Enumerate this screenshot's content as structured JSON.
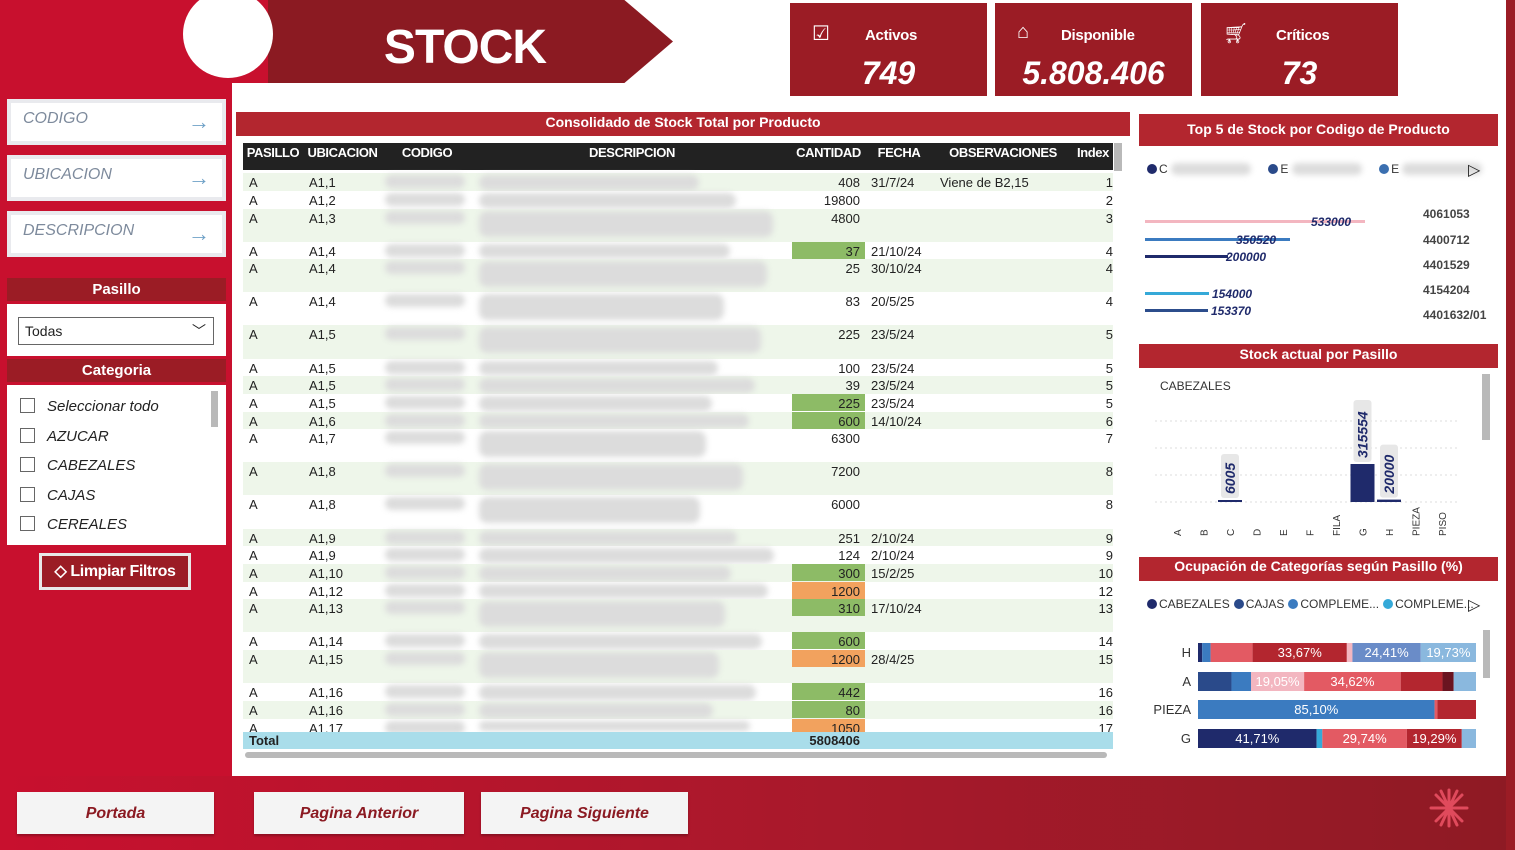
{
  "header": {
    "title": "STOCK"
  },
  "kpis": [
    {
      "label": "Activos",
      "value": "749",
      "icon": "checklist-icon"
    },
    {
      "label": "Disponible",
      "value": "5.808.406",
      "icon": "warehouse-icon"
    },
    {
      "label": "Críticos",
      "value": "73",
      "icon": "cart-icon"
    }
  ],
  "filters": {
    "codigo_placeholder": "CODIGO",
    "ubicacion_placeholder": "UBICACION",
    "descripcion_placeholder": "DESCRIPCION",
    "pasillo_label": "Pasillo",
    "pasillo_value": "Todas",
    "categoria_label": "Categoria",
    "categorias": [
      "Seleccionar todo",
      "AZUCAR",
      "CABEZALES",
      "CAJAS",
      "CEREALES"
    ],
    "clear_label": "Limpiar Filtros"
  },
  "nav": {
    "portada": "Portada",
    "anterior": "Pagina Anterior",
    "siguiente": "Pagina Siguiente"
  },
  "table": {
    "title": "Consolidado de Stock Total por Producto",
    "columns": [
      "PASILLO",
      "UBICACION",
      "CODIGO",
      "DESCRIPCION",
      "CANTIDAD",
      "FECHA",
      "OBSERVACIONES",
      "Index"
    ],
    "rows": [
      {
        "pasillo": "A",
        "ubicacion": "A1,1",
        "cantidad": "408",
        "fecha": "31/7/24",
        "obs": "Viene de B2,15",
        "index": "1",
        "shade": "w"
      },
      {
        "pasillo": "A",
        "ubicacion": "A1,2",
        "cantidad": "19800",
        "fecha": "",
        "obs": "",
        "index": "2",
        "shade": "w"
      },
      {
        "pasillo": "A",
        "ubicacion": "A1,3",
        "cantidad": "4800",
        "fecha": "",
        "obs": "",
        "index": "3",
        "shade": "w"
      },
      {
        "pasillo": "A",
        "ubicacion": "A1,4",
        "cantidad": "37",
        "fecha": "21/10/24",
        "obs": "",
        "index": "4",
        "shade": "g"
      },
      {
        "pasillo": "A",
        "ubicacion": "A1,4",
        "cantidad": "25",
        "fecha": "30/10/24",
        "obs": "",
        "index": "4",
        "shade": "w"
      },
      {
        "pasillo": "A",
        "ubicacion": "A1,4",
        "cantidad": "83",
        "fecha": "20/5/25",
        "obs": "",
        "index": "4",
        "shade": "w"
      },
      {
        "pasillo": "A",
        "ubicacion": "A1,5",
        "cantidad": "225",
        "fecha": "23/5/24",
        "obs": "",
        "index": "5",
        "shade": "w"
      },
      {
        "pasillo": "A",
        "ubicacion": "A1,5",
        "cantidad": "100",
        "fecha": "23/5/24",
        "obs": "",
        "index": "5",
        "shade": "w"
      },
      {
        "pasillo": "A",
        "ubicacion": "A1,5",
        "cantidad": "39",
        "fecha": "23/5/24",
        "obs": "",
        "index": "5",
        "shade": "w"
      },
      {
        "pasillo": "A",
        "ubicacion": "A1,5",
        "cantidad": "225",
        "fecha": "23/5/24",
        "obs": "",
        "index": "5",
        "shade": "g"
      },
      {
        "pasillo": "A",
        "ubicacion": "A1,6",
        "cantidad": "600",
        "fecha": "14/10/24",
        "obs": "",
        "index": "6",
        "shade": "g"
      },
      {
        "pasillo": "A",
        "ubicacion": "A1,7",
        "cantidad": "6300",
        "fecha": "",
        "obs": "",
        "index": "7",
        "shade": "w"
      },
      {
        "pasillo": "A",
        "ubicacion": "A1,8",
        "cantidad": "7200",
        "fecha": "",
        "obs": "",
        "index": "8",
        "shade": "w"
      },
      {
        "pasillo": "A",
        "ubicacion": "A1,8",
        "cantidad": "6000",
        "fecha": "",
        "obs": "",
        "index": "8",
        "shade": "w"
      },
      {
        "pasillo": "A",
        "ubicacion": "A1,9",
        "cantidad": "251",
        "fecha": "2/10/24",
        "obs": "",
        "index": "9",
        "shade": "w"
      },
      {
        "pasillo": "A",
        "ubicacion": "A1,9",
        "cantidad": "124",
        "fecha": "2/10/24",
        "obs": "",
        "index": "9",
        "shade": "w"
      },
      {
        "pasillo": "A",
        "ubicacion": "A1,10",
        "cantidad": "300",
        "fecha": "15/2/25",
        "obs": "",
        "index": "10",
        "shade": "g"
      },
      {
        "pasillo": "A",
        "ubicacion": "A1,12",
        "cantidad": "1200",
        "fecha": "",
        "obs": "",
        "index": "12",
        "shade": "o"
      },
      {
        "pasillo": "A",
        "ubicacion": "A1,13",
        "cantidad": "310",
        "fecha": "17/10/24",
        "obs": "",
        "index": "13",
        "shade": "g"
      },
      {
        "pasillo": "A",
        "ubicacion": "A1,14",
        "cantidad": "600",
        "fecha": "",
        "obs": "",
        "index": "14",
        "shade": "g"
      },
      {
        "pasillo": "A",
        "ubicacion": "A1,15",
        "cantidad": "1200",
        "fecha": "28/4/25",
        "obs": "",
        "index": "15",
        "shade": "o"
      },
      {
        "pasillo": "A",
        "ubicacion": "A1,16",
        "cantidad": "442",
        "fecha": "",
        "obs": "",
        "index": "16",
        "shade": "g"
      },
      {
        "pasillo": "A",
        "ubicacion": "A1,16",
        "cantidad": "80",
        "fecha": "",
        "obs": "",
        "index": "16",
        "shade": "g"
      },
      {
        "pasillo": "A",
        "ubicacion": "A1,17",
        "cantidad": "1050",
        "fecha": "",
        "obs": "",
        "index": "17",
        "shade": "o"
      }
    ],
    "total_label": "Total",
    "total_value": "5808406"
  },
  "top5": {
    "title": "Top 5 de Stock por Codigo de Producto",
    "legend": [
      "C",
      "E",
      "E"
    ],
    "legend_colors": [
      "#1f2a6b",
      "#2a4a8a",
      "#3b6fb0"
    ]
  },
  "chart_data": [
    {
      "type": "bar",
      "title": "Top 5 de Stock por Codigo de Producto",
      "categories": [
        "4061053",
        "4400712",
        "4401529",
        "4154204",
        "4401632/01"
      ],
      "values": [
        533000,
        350520,
        200000,
        154000,
        153370
      ],
      "colors": [
        "#f3b6c0",
        "#3b7bc0",
        "#1f2a6b",
        "#35a9d8",
        "#2c4d8c"
      ],
      "value_labels": [
        "533000",
        "350520",
        "200000",
        "154000",
        "153370"
      ]
    },
    {
      "type": "bar",
      "title": "Stock actual por Pasillo",
      "legend_label": "CABEZALES",
      "categories": [
        "A",
        "B",
        "C",
        "D",
        "E",
        "F",
        "FILA",
        "G",
        "H",
        "PIEZA",
        "PISO"
      ],
      "values": [
        0,
        0,
        6005,
        0,
        0,
        0,
        0,
        315554,
        20000,
        0,
        0
      ],
      "value_labels": [
        "",
        "",
        "6005",
        "",
        "",
        "",
        "",
        "315554",
        "20000",
        "",
        ""
      ]
    },
    {
      "type": "bar",
      "title": "Ocupación de Categorías según Pasillo (%)",
      "legend": [
        {
          "name": "CABEZALES",
          "color": "#1f2a6b"
        },
        {
          "name": "CAJAS",
          "color": "#2a4a8a"
        },
        {
          "name": "COMPLEME...",
          "color": "#3b7bc0"
        },
        {
          "name": "COMPLEME...",
          "color": "#35a9d8"
        }
      ],
      "categories": [
        "H",
        "A",
        "PIEZA",
        "G"
      ],
      "rows": [
        {
          "segments": [
            {
              "v": 1.5,
              "c": "#1f2a6b"
            },
            {
              "v": 3,
              "c": "#3b7bc0"
            },
            {
              "v": 15,
              "c": "#e35a63"
            },
            {
              "v": 33.67,
              "c": "#b3262f",
              "label": "33,67%"
            },
            {
              "v": 2,
              "c": "#f3b6c0"
            },
            {
              "v": 24.41,
              "c": "#6a8cc8",
              "label": "24,41%"
            },
            {
              "v": 19.73,
              "c": "#8ab8de",
              "label": "19,73%"
            }
          ]
        },
        {
          "segments": [
            {
              "v": 12,
              "c": "#2a4a8a"
            },
            {
              "v": 7,
              "c": "#3b7bc0"
            },
            {
              "v": 19.05,
              "c": "#f3b6c0",
              "label": "19,05%"
            },
            {
              "v": 34.62,
              "c": "#e35a63",
              "label": "34,62%"
            },
            {
              "v": 15,
              "c": "#b3262f"
            },
            {
              "v": 4,
              "c": "#6a1420"
            },
            {
              "v": 8,
              "c": "#8ab8de"
            }
          ]
        },
        {
          "segments": [
            {
              "v": 85.1,
              "c": "#3b7bc0",
              "label": "85,10%"
            },
            {
              "v": 1,
              "c": "#e35a63"
            },
            {
              "v": 13.9,
              "c": "#b3262f"
            }
          ]
        },
        {
          "segments": [
            {
              "v": 41.71,
              "c": "#1f2a6b",
              "label": "41,71%"
            },
            {
              "v": 2,
              "c": "#35a9d8"
            },
            {
              "v": 29.74,
              "c": "#e35a63",
              "label": "29,74%"
            },
            {
              "v": 19.29,
              "c": "#b3262f",
              "label": "19,29%"
            },
            {
              "v": 5,
              "c": "#8ab8de"
            }
          ]
        }
      ]
    }
  ]
}
